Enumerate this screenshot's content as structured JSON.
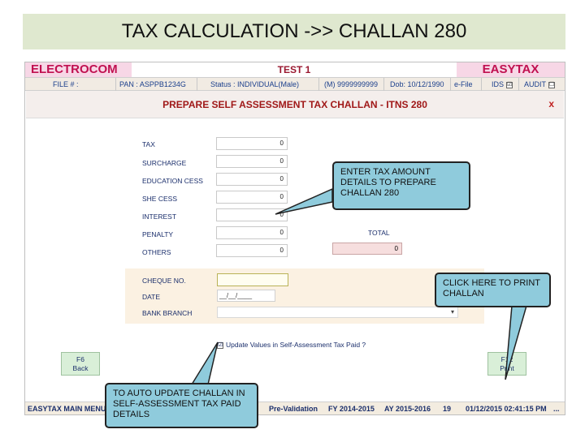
{
  "slide": {
    "title": "TAX CALCULATION ->> CHALLAN 280"
  },
  "header": {
    "brand_left": "ELECTROCOM",
    "title": "TEST 1",
    "brand_right": "EASYTAX",
    "file": "FILE # :",
    "pan": "PAN : ASPPB1234G",
    "status": "Status : INDIVIDUAL(Male)",
    "mobile": "(M) 9999999999",
    "dob": "Dob: 10/12/1990",
    "efile": "e-File",
    "ids": "IDS",
    "ids_checked": "☑",
    "audit": "AUDIT",
    "audit_checked": "☐"
  },
  "dialog": {
    "title": "PREPARE SELF ASSESSMENT TAX CHALLAN - ITNS 280",
    "close": "x",
    "fields": [
      {
        "label": "TAX",
        "value": "0"
      },
      {
        "label": "SURCHARGE",
        "value": "0"
      },
      {
        "label": "EDUCATION CESS",
        "value": "0"
      },
      {
        "label": "SHE CESS",
        "value": "0"
      },
      {
        "label": "INTEREST",
        "value": "0"
      },
      {
        "label": "PENALTY",
        "value": "0"
      },
      {
        "label": "OTHERS",
        "value": "0"
      }
    ],
    "total_label": "TOTAL",
    "total_value": "0",
    "cheque_label": "CHEQUE NO.",
    "date_label": "DATE",
    "date_value": "__/__/____",
    "bank_label": "BANK BRANCH",
    "bank_value": "▾",
    "update_checkbox": "☑",
    "update_label": "Update Values in Self-Assessment Tax Paid ?",
    "back_button": {
      "key": "F6",
      "label": "Back"
    },
    "print_button": {
      "key": "F12",
      "label": "Print"
    }
  },
  "footer": {
    "menu": "EASYTAX MAIN MENU",
    "prevalidation": "Pre-Validation",
    "fy": "FY 2014-2015",
    "ay": "AY 2015-2016",
    "count": "19",
    "datetime": "01/12/2015 02:41:15 PM",
    "more": "..."
  },
  "callouts": {
    "amount": "ENTER TAX AMOUNT DETAILS TO PREPARE CHALLAN 280",
    "print": "CLICK HERE TO PRINT CHALLAN",
    "update": "TO AUTO UPDATE CHALLAN IN SELF-ASSESSMENT TAX PAID DETAILS"
  },
  "colors": {
    "brand": "#c01050",
    "callout": "#8fcbdc",
    "title_band": "#dfe8cf",
    "button": "#d9efd8"
  }
}
